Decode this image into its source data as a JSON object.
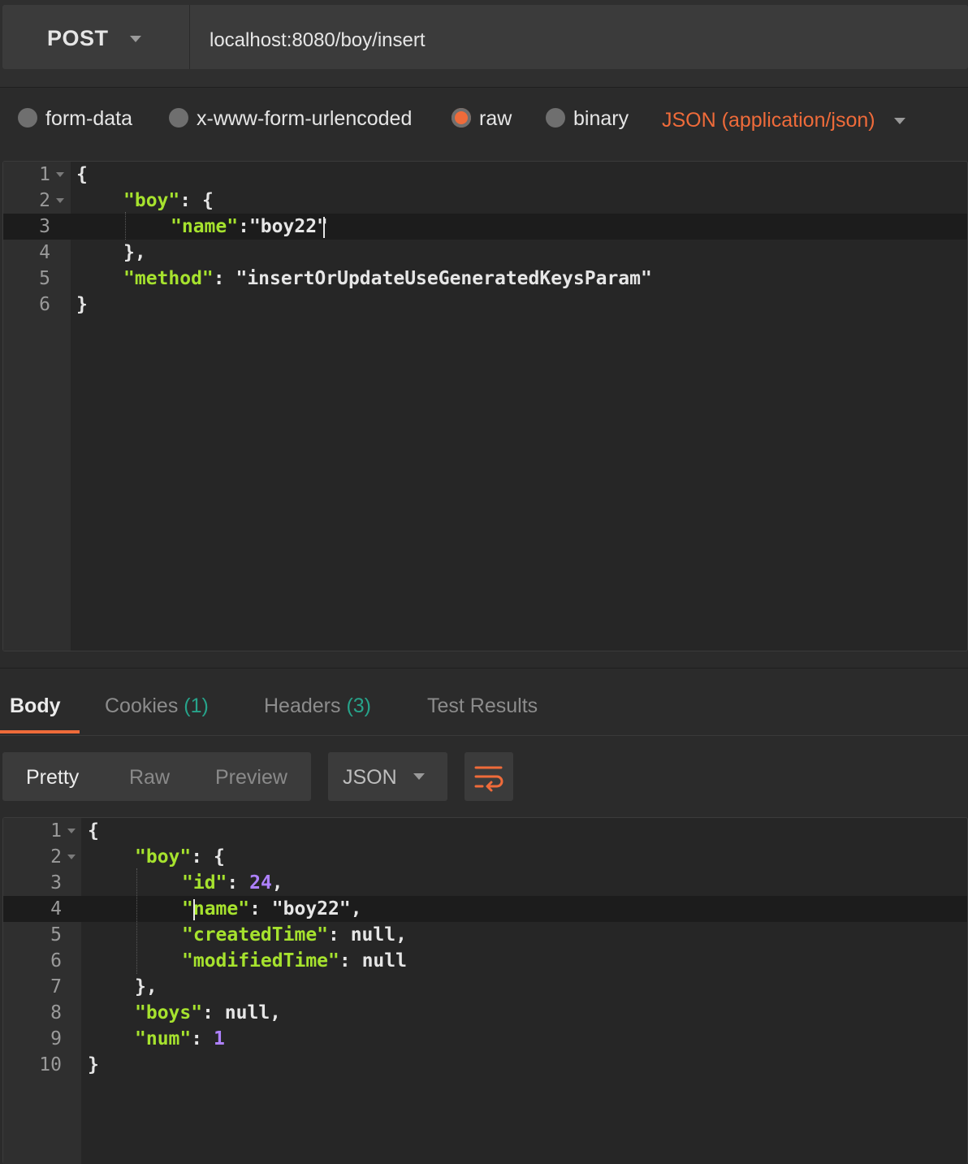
{
  "request": {
    "method": "POST",
    "url": "localhost:8080/boy/insert"
  },
  "body_types": {
    "options": [
      "form-data",
      "x-www-form-urlencoded",
      "raw",
      "binary"
    ],
    "selected": "raw",
    "content_type": "JSON (application/json)"
  },
  "request_body": {
    "lines": [
      {
        "n": "1",
        "text": "{"
      },
      {
        "n": "2",
        "text": "\"boy\": {"
      },
      {
        "n": "3",
        "text": "\"name\":\"boy22\""
      },
      {
        "n": "4",
        "text": "},"
      },
      {
        "n": "5",
        "text": "\"method\": \"insertOrUpdateUseGeneratedKeysParam\""
      },
      {
        "n": "6",
        "text": "}"
      }
    ],
    "tokens": {
      "l2_key": "\"boy\"",
      "l2_rest": ": {",
      "l3_key": "\"name\"",
      "l3_sep": ":",
      "l3_val": "\"boy22\"",
      "l5_key": "\"method\"",
      "l5_sep": ": ",
      "l5_val": "\"insertOrUpdateUseGeneratedKeysParam\""
    }
  },
  "response": {
    "tabs": {
      "body": "Body",
      "cookies": "Cookies",
      "cookies_count": "(1)",
      "headers": "Headers",
      "headers_count": "(3)",
      "tests": "Test Results"
    },
    "view_modes": {
      "pretty": "Pretty",
      "raw": "Raw",
      "preview": "Preview",
      "selected": "Pretty"
    },
    "format": "JSON",
    "wrap_icon": "wrap-lines-icon",
    "lines": [
      {
        "n": "1"
      },
      {
        "n": "2"
      },
      {
        "n": "3"
      },
      {
        "n": "4"
      },
      {
        "n": "5"
      },
      {
        "n": "6"
      },
      {
        "n": "7"
      },
      {
        "n": "8"
      },
      {
        "n": "9"
      },
      {
        "n": "10"
      }
    ],
    "tokens": {
      "l1": "{",
      "l2_key": "\"boy\"",
      "l2_rest": ": {",
      "l3_key": "\"id\"",
      "l3_sep": ": ",
      "l3_val": "24",
      "l3_end": ",",
      "l4_key": "\"name\"",
      "l4_sep": ": ",
      "l4_val": "\"boy22\"",
      "l4_end": ",",
      "l5_key": "\"createdTime\"",
      "l5_rest": ": null,",
      "l6_key": "\"modifiedTime\"",
      "l6_rest": ": null",
      "l7": "},",
      "l8_key": "\"boys\"",
      "l8_rest": ": null,",
      "l9_key": "\"num\"",
      "l9_sep": ": ",
      "l9_val": "1",
      "l10": "}"
    }
  },
  "colors": {
    "accent": "#ef6b3a",
    "key": "#a6e22e",
    "number": "#ae81ff",
    "count": "#27a38a"
  }
}
